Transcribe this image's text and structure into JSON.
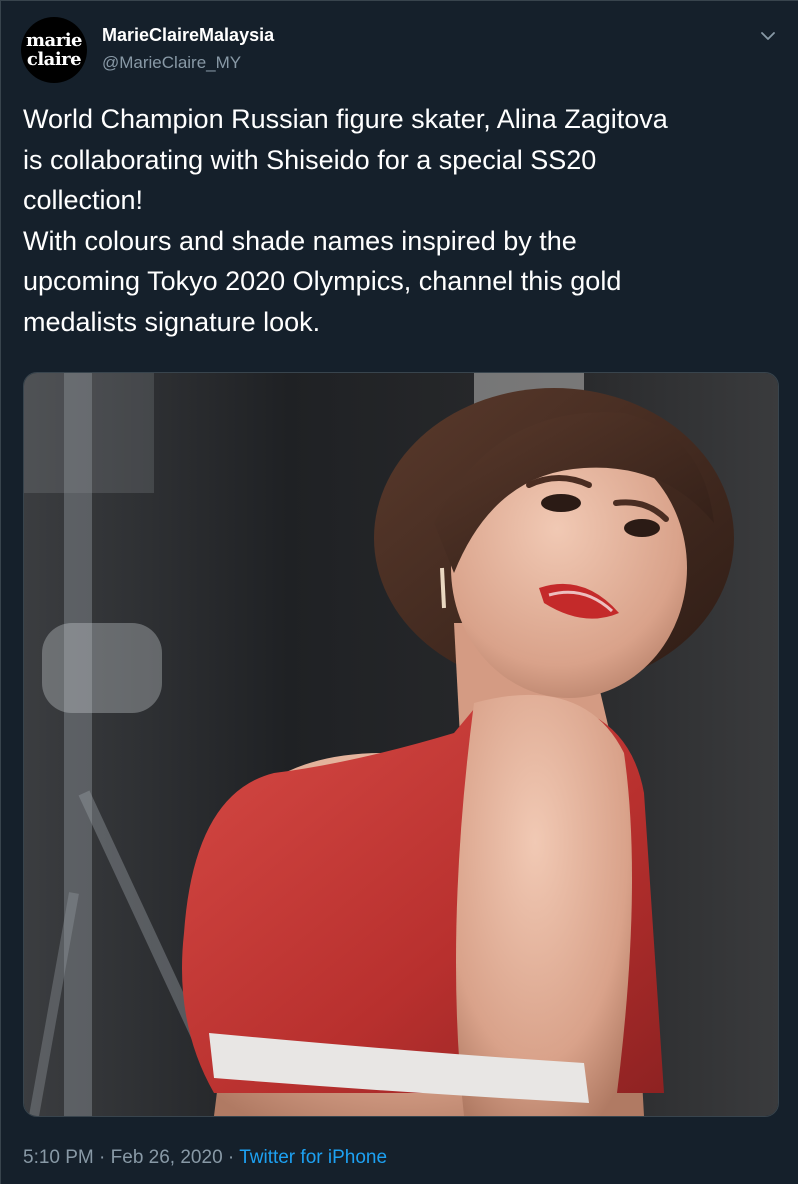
{
  "account": {
    "avatar_line1": "marie",
    "avatar_line2": "claire",
    "display_name": "MarieClaireMalaysia",
    "handle": "@MarieClaire_MY"
  },
  "tweet": {
    "lines": [
      "World Champion Russian figure skater, Alina Zagitova",
      "is collaborating with Shiseido for a special SS20",
      "collection!",
      "With colours and shade names inspired by the",
      "upcoming Tokyo 2020 Olympics, channel this gold",
      "medalists signature look."
    ],
    "time": "5:10 PM",
    "separator": "·",
    "date": "Feb 26, 2020",
    "source": "Twitter for iPhone"
  },
  "icons": {
    "menu": "chevron-down-icon"
  },
  "colors": {
    "background": "#15202b",
    "secondary_text": "#8899a6",
    "link": "#1da1f2",
    "border": "#38444d"
  }
}
